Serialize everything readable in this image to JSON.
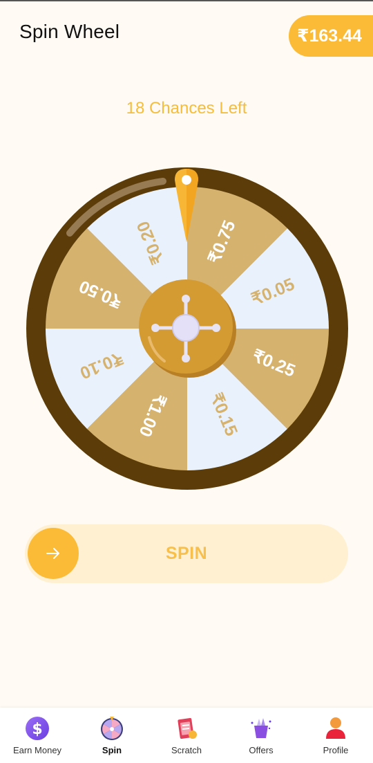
{
  "header": {
    "title": "Spin Wheel",
    "balance": "₹163.44"
  },
  "status": {
    "chances": "18 Chances Left"
  },
  "wheel": {
    "prizes": [
      "₹0.75",
      "₹0.05",
      "₹0.25",
      "₹0.15",
      "₹1.00",
      "₹0.10",
      "₹0.50",
      "₹0.20"
    ],
    "colors": {
      "rim": "#5c3d09",
      "segment_gold": "#d6b26f",
      "segment_light": "#e9f2fc",
      "hub": "#d49b33",
      "pointer": "#f7b636"
    }
  },
  "spin": {
    "label": "SPIN",
    "arrow_icon": "arrow-right-icon"
  },
  "nav": {
    "items": [
      {
        "label": "Earn Money",
        "icon": "dollar-coin-icon",
        "active": false
      },
      {
        "label": "Spin",
        "icon": "wheel-icon",
        "active": true
      },
      {
        "label": "Scratch",
        "icon": "scratch-card-icon",
        "active": false
      },
      {
        "label": "Offers",
        "icon": "gift-icon",
        "active": false
      },
      {
        "label": "Profile",
        "icon": "user-icon",
        "active": false
      }
    ]
  }
}
